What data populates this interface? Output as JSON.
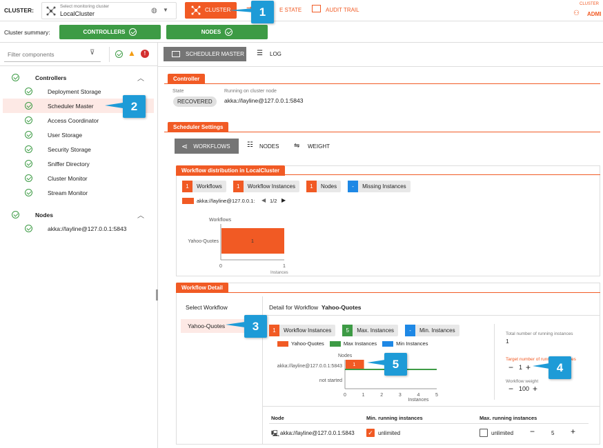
{
  "topbar": {
    "cluster_label": "CLUSTER:",
    "select_hint": "Select monitoring cluster",
    "cluster_name": "LocalCluster",
    "tab_cluster": "CLUSTER",
    "tab_state": "E STATE",
    "tab_audit": "AUDIT TRAIL",
    "user_caption": "CLUSTER",
    "user_name": "ADMI"
  },
  "summary": {
    "label": "Cluster summary:",
    "controllers": "CONTROLLERS",
    "nodes": "NODES"
  },
  "sidebar": {
    "filter_placeholder": "Filter components",
    "controllers_header": "Controllers",
    "controllers": [
      "Deployment Storage",
      "Scheduler Master",
      "Access Coordinator",
      "User Storage",
      "Security Storage",
      "Sniffer Directory",
      "Cluster Monitor",
      "Stream Monitor"
    ],
    "nodes_header": "Nodes",
    "nodes": [
      "akka://layline@127.0.0.1:5843"
    ]
  },
  "main": {
    "tab_scheduler": "SCHEDULER MASTER",
    "tab_log": "LOG",
    "controller": {
      "title": "Controller",
      "state_label": "State",
      "state_value": "RECOVERED",
      "node_label": "Running on cluster node",
      "node_value": "akka://layline@127.0.0.1:5843"
    },
    "settings": {
      "title": "Scheduler Settings",
      "tab_workflows": "WORKFLOWS",
      "tab_nodes": "NODES",
      "tab_weight": "WEIGHT"
    },
    "distribution": {
      "title": "Workflow distribution in LocalCluster",
      "chips": [
        {
          "num": "1",
          "label": "Workflows",
          "color": "#f15a24"
        },
        {
          "num": "1",
          "label": "Workflow Instances",
          "color": "#f15a24"
        },
        {
          "num": "1",
          "label": "Nodes",
          "color": "#f15a24"
        },
        {
          "num": "-",
          "label": "Missing Instances",
          "color": "#1e88e5"
        }
      ],
      "legend_node": "akka://layline@127.0.0.1:",
      "pager": "1/2"
    },
    "detail": {
      "title": "Workflow Detail",
      "select_label": "Select Workflow",
      "workflow_item": "Yahoo-Quotes",
      "detail_prefix": "Detail for Workflow",
      "detail_name": "Yahoo-Quotes",
      "chips": [
        {
          "num": "1",
          "label": "Workflow Instances",
          "color": "#f15a24"
        },
        {
          "num": "5",
          "label": "Max. Instances",
          "color": "#3d9b45"
        },
        {
          "num": "-",
          "label": "Min. Instances",
          "color": "#1e88e5"
        }
      ],
      "legend": [
        {
          "label": "Yahoo-Quotes",
          "color": "#f15a24"
        },
        {
          "label": "Max Instances",
          "color": "#3d9b45"
        },
        {
          "label": "Min Instances",
          "color": "#1e88e5"
        }
      ],
      "total_label": "Total number of running instances",
      "total_value": "1",
      "target_label": "Target number of running instances",
      "target_value": "1",
      "weight_label": "Workflow weight",
      "weight_value": "100",
      "table": {
        "col_node": "Node",
        "col_min": "Min. running instances",
        "col_max": "Max. running instances",
        "row_node": "akka://layline@127.0.0.1:5843",
        "min_value": "unlimited",
        "max_value": "unlimited",
        "max_count": "5"
      }
    }
  },
  "callouts": [
    "1",
    "2",
    "3",
    "4",
    "5"
  ],
  "chart_data": [
    {
      "type": "bar",
      "title": "",
      "xlabel": "Instances",
      "ylabel": "Workflows",
      "categories": [
        "Yahoo-Quotes"
      ],
      "series": [
        {
          "name": "akka://layline@127.0.0.1:",
          "values": [
            1
          ]
        }
      ],
      "xlim": [
        0,
        1
      ],
      "xticks": [
        "0",
        "1"
      ],
      "data_labels": [
        "1"
      ]
    },
    {
      "type": "bar",
      "title": "",
      "xlabel": "Instances",
      "ylabel": "Nodes",
      "categories": [
        "akka://layline@127.0.0.1:5843",
        "not started"
      ],
      "series": [
        {
          "name": "Yahoo-Quotes",
          "values": [
            1,
            0
          ]
        },
        {
          "name": "Max Instances",
          "values": [
            5,
            0
          ]
        },
        {
          "name": "Min Instances",
          "values": [
            0,
            0
          ]
        }
      ],
      "xlim": [
        0,
        5
      ],
      "xticks": [
        "0",
        "1",
        "2",
        "3",
        "4",
        "5"
      ],
      "data_labels": [
        "1"
      ]
    }
  ],
  "colors": {
    "accent": "#f15a24",
    "success": "#3d9b45",
    "info": "#1e88e5",
    "callout": "#1e9bd7"
  }
}
